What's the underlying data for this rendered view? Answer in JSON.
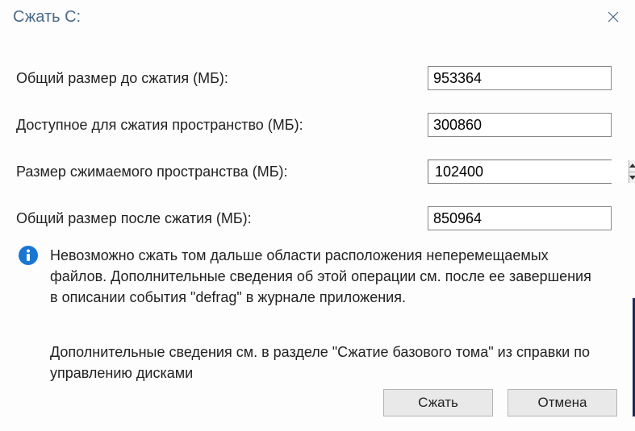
{
  "title": "Сжать С:",
  "fields": {
    "totalBefore": {
      "label": "Общий размер до сжатия (МБ):",
      "value": "953364"
    },
    "available": {
      "label": "Доступное для сжатия пространство (МБ):",
      "value": "300860"
    },
    "shrinkSize": {
      "label": "Размер сжимаемого пространства (МБ):",
      "value": "102400"
    },
    "totalAfter": {
      "label": "Общий размер после сжатия (МБ):",
      "value": "850964"
    }
  },
  "info": "Невозможно сжать том дальше области расположения неперемещаемых файлов. Дополнительные сведения об этой операции см. после ее завершения в описании события \"defrag\" в журнале приложения.",
  "extra": "Дополнительные сведения см. в разделе \"Сжатие базового тома\" из справки по управлению дисками",
  "buttons": {
    "shrink": "Сжать",
    "cancel": "Отмена"
  }
}
